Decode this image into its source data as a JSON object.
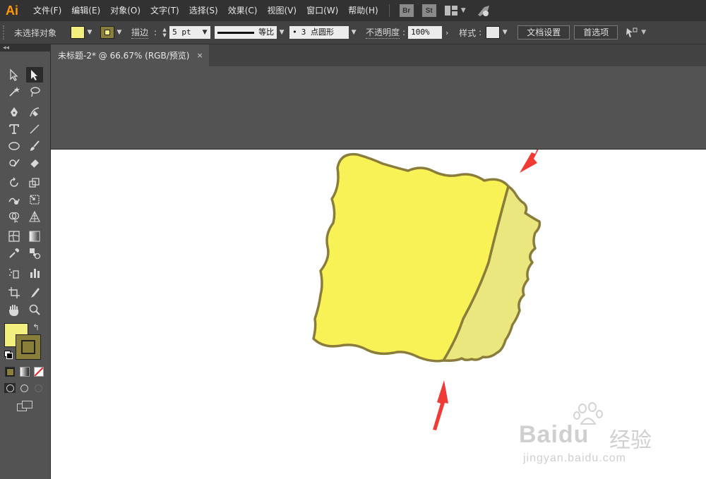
{
  "app": {
    "logo": "Ai",
    "brand_color": "#ff9a00"
  },
  "menu": [
    "文件(F)",
    "编辑(E)",
    "对象(O)",
    "文字(T)",
    "选择(S)",
    "效果(C)",
    "视图(V)",
    "窗口(W)",
    "帮助(H)"
  ],
  "menu_icons": {
    "bridge": "Br",
    "stock": "St"
  },
  "control_bar": {
    "selection_status": "未选择对象",
    "fill_color": "#f3ef7f",
    "stroke_color": "#8a7f3a",
    "stroke_label": "描边",
    "stroke_weight": "5 pt",
    "stroke_profile": "等比",
    "brush": "3 点圆形",
    "opacity_label": "不透明度",
    "opacity_value": "100%",
    "style_label": "样式",
    "doc_setup": "文档设置",
    "preferences": "首选项"
  },
  "tab": {
    "title": "未标题-2* @ 66.67% (RGB/预览)",
    "close": "×"
  },
  "artwork": {
    "front_face_color": "#f9f257",
    "side_face_color": "#ebe77f",
    "outline_color": "#8a7d3c",
    "arrow_color": "#ef3a35"
  },
  "watermark": {
    "brand": "Baidu",
    "product": "经验",
    "url": "jingyan.baidu.com"
  },
  "toolbar": {
    "fill_color": "#f3ef7f",
    "stroke_color": "#8a7f3a"
  }
}
